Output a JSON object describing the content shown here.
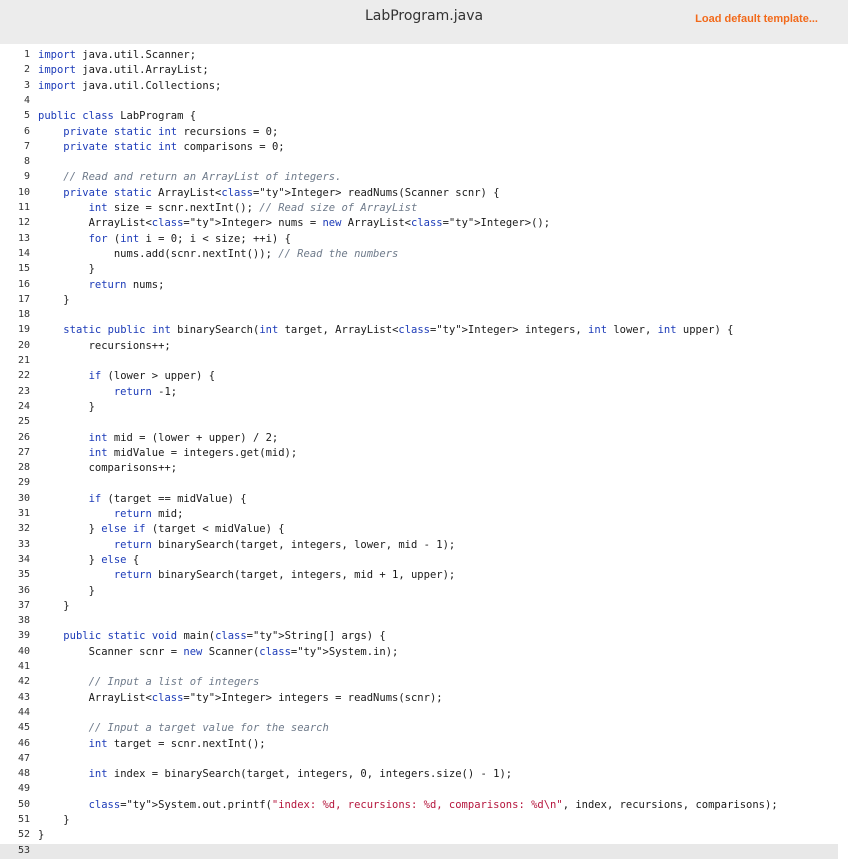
{
  "header": {
    "title": "LabProgram.java",
    "load_label": "Load default template..."
  },
  "editor": {
    "lines": [
      {
        "n": "1",
        "t": "import java.util.Scanner;"
      },
      {
        "n": "2",
        "t": "import java.util.ArrayList;"
      },
      {
        "n": "3",
        "t": "import java.util.Collections;"
      },
      {
        "n": "4",
        "t": ""
      },
      {
        "n": "5",
        "t": "public class LabProgram {"
      },
      {
        "n": "6",
        "t": "    private static int recursions = 0;"
      },
      {
        "n": "7",
        "t": "    private static int comparisons = 0;"
      },
      {
        "n": "8",
        "t": ""
      },
      {
        "n": "9",
        "t": "    // Read and return an ArrayList of integers."
      },
      {
        "n": "10",
        "t": "    private static ArrayList<Integer> readNums(Scanner scnr) {"
      },
      {
        "n": "11",
        "t": "        int size = scnr.nextInt(); // Read size of ArrayList"
      },
      {
        "n": "12",
        "t": "        ArrayList<Integer> nums = new ArrayList<Integer>();"
      },
      {
        "n": "13",
        "t": "        for (int i = 0; i < size; ++i) {"
      },
      {
        "n": "14",
        "t": "            nums.add(scnr.nextInt()); // Read the numbers"
      },
      {
        "n": "15",
        "t": "        }"
      },
      {
        "n": "16",
        "t": "        return nums;"
      },
      {
        "n": "17",
        "t": "    }"
      },
      {
        "n": "18",
        "t": ""
      },
      {
        "n": "19",
        "t": "    static public int binarySearch(int target, ArrayList<Integer> integers, int lower, int upper) {"
      },
      {
        "n": "20",
        "t": "        recursions++;"
      },
      {
        "n": "21",
        "t": ""
      },
      {
        "n": "22",
        "t": "        if (lower > upper) {"
      },
      {
        "n": "23",
        "t": "            return -1;"
      },
      {
        "n": "24",
        "t": "        }"
      },
      {
        "n": "25",
        "t": ""
      },
      {
        "n": "26",
        "t": "        int mid = (lower + upper) / 2;"
      },
      {
        "n": "27",
        "t": "        int midValue = integers.get(mid);"
      },
      {
        "n": "28",
        "t": "        comparisons++;"
      },
      {
        "n": "29",
        "t": ""
      },
      {
        "n": "30",
        "t": "        if (target == midValue) {"
      },
      {
        "n": "31",
        "t": "            return mid;"
      },
      {
        "n": "32",
        "t": "        } else if (target < midValue) {"
      },
      {
        "n": "33",
        "t": "            return binarySearch(target, integers, lower, mid - 1);"
      },
      {
        "n": "34",
        "t": "        } else {"
      },
      {
        "n": "35",
        "t": "            return binarySearch(target, integers, mid + 1, upper);"
      },
      {
        "n": "36",
        "t": "        }"
      },
      {
        "n": "37",
        "t": "    }"
      },
      {
        "n": "38",
        "t": ""
      },
      {
        "n": "39",
        "t": "    public static void main(String[] args) {"
      },
      {
        "n": "40",
        "t": "        Scanner scnr = new Scanner(System.in);"
      },
      {
        "n": "41",
        "t": ""
      },
      {
        "n": "42",
        "t": "        // Input a list of integers"
      },
      {
        "n": "43",
        "t": "        ArrayList<Integer> integers = readNums(scnr);"
      },
      {
        "n": "44",
        "t": ""
      },
      {
        "n": "45",
        "t": "        // Input a target value for the search"
      },
      {
        "n": "46",
        "t": "        int target = scnr.nextInt();"
      },
      {
        "n": "47",
        "t": ""
      },
      {
        "n": "48",
        "t": "        int index = binarySearch(target, integers, 0, integers.size() - 1);"
      },
      {
        "n": "49",
        "t": ""
      },
      {
        "n": "50",
        "t": "        System.out.printf(\"index: %d, recursions: %d, comparisons: %d\\n\", index, recursions, comparisons);"
      },
      {
        "n": "51",
        "t": "    }"
      },
      {
        "n": "52",
        "t": "}"
      },
      {
        "n": "53",
        "t": ""
      }
    ]
  }
}
